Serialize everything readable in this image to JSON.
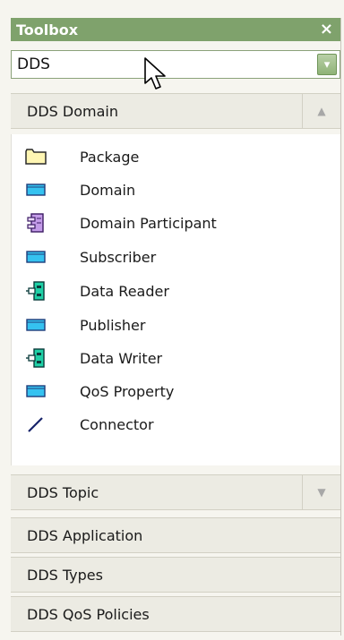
{
  "toolbox": {
    "title": "Toolbox",
    "close_glyph": "×",
    "combo_value": "DDS",
    "combo_arrow_glyph": "▾"
  },
  "sections": [
    {
      "label": "DDS Domain",
      "expanded": true,
      "arrow": "▲"
    },
    {
      "label": "DDS Topic",
      "expanded": false,
      "arrow": "▼"
    },
    {
      "label": "DDS Application",
      "expanded": false
    },
    {
      "label": "DDS Types",
      "expanded": false
    },
    {
      "label": "DDS QoS Policies",
      "expanded": false
    }
  ],
  "items": [
    {
      "label": "Package",
      "icon": "folder-icon"
    },
    {
      "label": "Domain",
      "icon": "class-icon"
    },
    {
      "label": "Domain Participant",
      "icon": "component-icon"
    },
    {
      "label": "Subscriber",
      "icon": "class-icon"
    },
    {
      "label": "Data Reader",
      "icon": "port-component-icon"
    },
    {
      "label": "Publisher",
      "icon": "class-icon"
    },
    {
      "label": "Data Writer",
      "icon": "port-component-icon"
    },
    {
      "label": "QoS Property",
      "icon": "class-icon"
    },
    {
      "label": "Connector",
      "icon": "connector-line-icon"
    }
  ],
  "colors": {
    "titlebar": "#7fa26c",
    "section_bg": "#ecebe3",
    "class_icon_fill": "#35c2f0",
    "folder_fill": "#fff6b3"
  }
}
